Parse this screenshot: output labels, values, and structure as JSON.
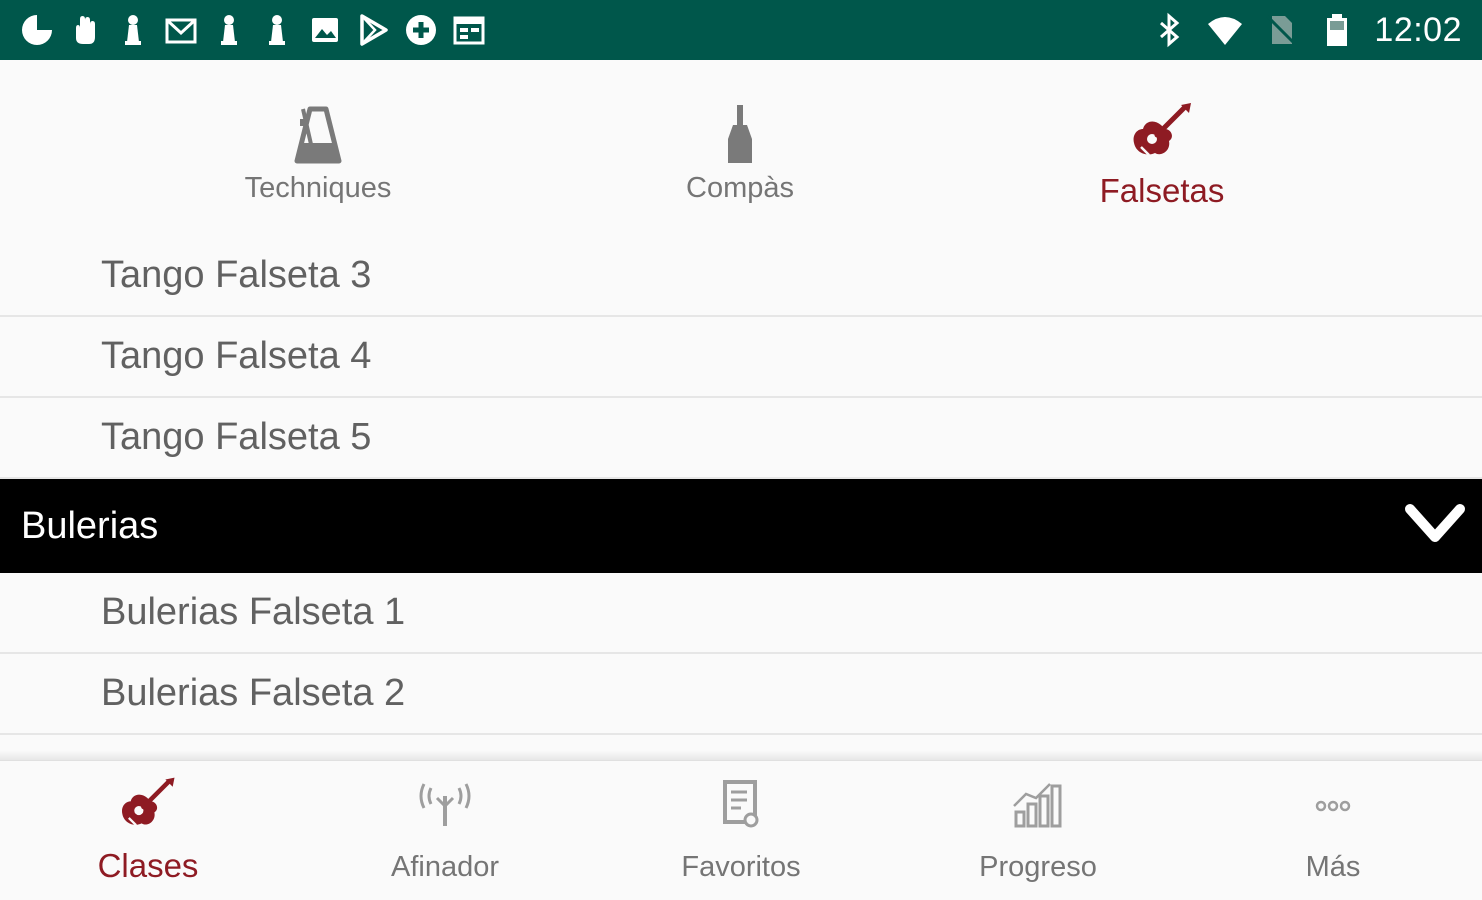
{
  "status_bar": {
    "background": "#00574b",
    "time": "12:02",
    "left_icons": [
      "pacman-icon",
      "hand-icon",
      "chess-pawn-icon",
      "gmail-icon",
      "chess-pawn-icon",
      "chess-pawn-icon",
      "image-icon",
      "play-store-icon",
      "plus-circle-icon",
      "calendar-icon"
    ],
    "right_icons": [
      "bluetooth-icon",
      "wifi-icon",
      "no-sim-icon",
      "battery-icon"
    ]
  },
  "top_tabs": {
    "items": [
      {
        "label": "Techniques",
        "icon": "metronome-icon",
        "active": false
      },
      {
        "label": "Compàs",
        "icon": "cajon-icon",
        "active": false
      },
      {
        "label": "Falsetas",
        "icon": "guitar-icon",
        "active": true
      }
    ]
  },
  "list": {
    "items_before": [
      "Tango Falseta 3",
      "Tango Falseta 4",
      "Tango Falseta 5"
    ],
    "section": {
      "label": "Bulerias",
      "icon": "chevron-down-icon",
      "expanded": true
    },
    "items_after": [
      "Bulerias Falseta 1",
      "Bulerias Falseta 2"
    ]
  },
  "bottom_nav": {
    "items": [
      {
        "label": "Clases",
        "icon": "guitar-icon",
        "active": true
      },
      {
        "label": "Afinador",
        "icon": "tuner-icon",
        "active": false
      },
      {
        "label": "Favoritos",
        "icon": "favorites-document-icon",
        "active": false
      },
      {
        "label": "Progreso",
        "icon": "bar-chart-icon",
        "active": false
      },
      {
        "label": "Más",
        "icon": "more-dots-icon",
        "active": false
      }
    ]
  },
  "colors": {
    "accent": "#8e1b23",
    "inactive": "#757575",
    "list_text": "#616161",
    "section_bg": "#000000"
  }
}
